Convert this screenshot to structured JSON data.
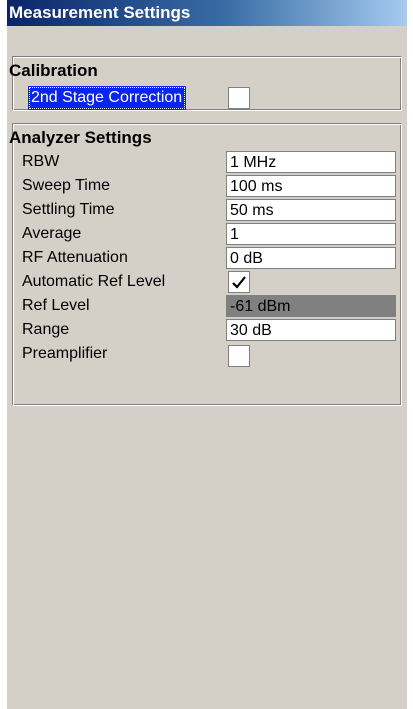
{
  "window": {
    "title": "Measurement Settings"
  },
  "calibration": {
    "heading": "Calibration",
    "second_stage_label": "2nd Stage Correction",
    "second_stage_checked": false
  },
  "analyzer": {
    "heading": "Analyzer Settings",
    "rbw": {
      "label": "RBW",
      "value": "1 MHz"
    },
    "sweep_time": {
      "label": "Sweep Time",
      "value": "100 ms"
    },
    "settling_time": {
      "label": "Settling Time",
      "value": "50 ms"
    },
    "average": {
      "label": "Average",
      "value": "1"
    },
    "rf_attenuation": {
      "label": "RF Attenuation",
      "value": "0 dB"
    },
    "auto_ref_level": {
      "label": "Automatic Ref Level",
      "checked": true
    },
    "ref_level": {
      "label": "Ref Level",
      "value": "-61 dBm",
      "disabled": true
    },
    "range": {
      "label": "Range",
      "value": "30 dB"
    },
    "preamplifier": {
      "label": "Preamplifier",
      "checked": false
    }
  },
  "colors": {
    "title_gradient_start": "#0a246a",
    "title_gradient_end": "#a6caf0",
    "panel_background": "#d4d0c8",
    "selection_highlight": "#0a24f0",
    "disabled_field": "#808080"
  },
  "icons": {
    "auto_ref_level_check": "checkmark-icon"
  }
}
